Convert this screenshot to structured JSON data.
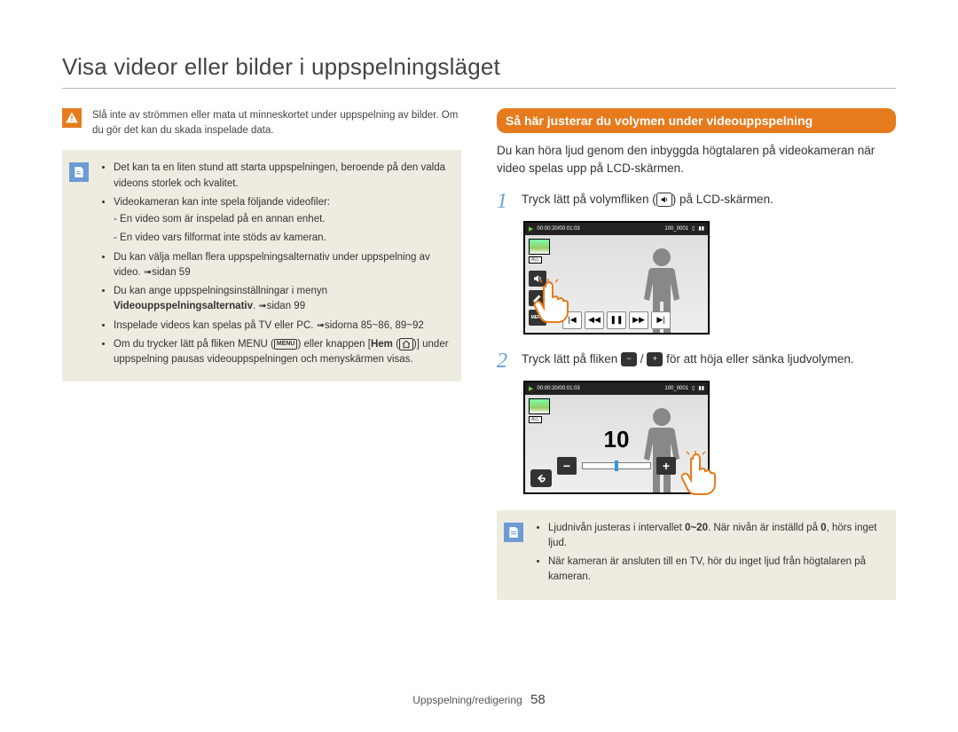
{
  "title": "Visa videor eller bilder i uppspelningsläget",
  "warning": {
    "text": "Slå inte av strömmen eller mata ut minneskortet under uppspelning av bilder. Om du gör det kan du skada inspelade data."
  },
  "info_left": {
    "items": [
      {
        "text": "Det kan ta en liten stund att starta uppspelningen, beroende på den valda videons storlek och kvalitet."
      },
      {
        "text": "Videokameran kan inte spela följande videofiler:",
        "sub": [
          "En video som är inspelad på en annan enhet.",
          "En video vars filformat inte stöds av kameran."
        ]
      },
      {
        "text": "Du kan välja mellan flera uppspelningsalternativ under uppspelning av video. ",
        "ref": "sidan 59"
      },
      {
        "text": "Du kan ange uppspelningsinställningar i menyn ",
        "bold": "Videouppspelningsalternativ",
        "after": ". ",
        "ref": "sidan 99"
      },
      {
        "text": "Inspelade videos kan spelas på TV eller PC. ",
        "ref": "sidorna 85~86, 89~92"
      },
      {
        "text_pre": "Om du trycker lätt på fliken MENU (",
        "menu_chip": "MENU",
        "text_mid": ") eller knappen [",
        "bold": "Hem",
        "text_mid2": " (",
        "home_icon": true,
        "text_post": ")] under uppspelning pausas videouppspelningen och menyskärmen visas."
      }
    ]
  },
  "section_header": "Så här justerar du volymen under videouppspelning",
  "intro_paragraph": "Du kan höra ljud genom den inbyggda högtalaren på videokameran när video spelas upp på LCD-skärmen.",
  "step1": {
    "num": "1",
    "text_pre": "Tryck lätt på volymfliken (",
    "text_post": ") på LCD-skärmen."
  },
  "step2": {
    "num": "2",
    "text_pre": "Tryck lätt på fliken ",
    "text_mid": " / ",
    "text_post": " för att höja eller sänka ljudvolymen."
  },
  "lcd": {
    "time": "00:00:20/00:01:03",
    "clip": "100_0001",
    "tag_all": "ALL",
    "menu": "MENU",
    "volume_value": "10"
  },
  "info_right": {
    "items": [
      {
        "text_a": "Ljudnivån justeras i intervallet ",
        "bold_a": "0~20",
        "text_b": ". När nivån är inställd på ",
        "bold_b": "0",
        "text_c": ", hörs inget ljud."
      },
      {
        "text": "När kameran är ansluten till en TV, hör du inget ljud från högtalaren på kameran."
      }
    ]
  },
  "footer": {
    "section": "Uppspelning/redigering",
    "page": "58"
  }
}
